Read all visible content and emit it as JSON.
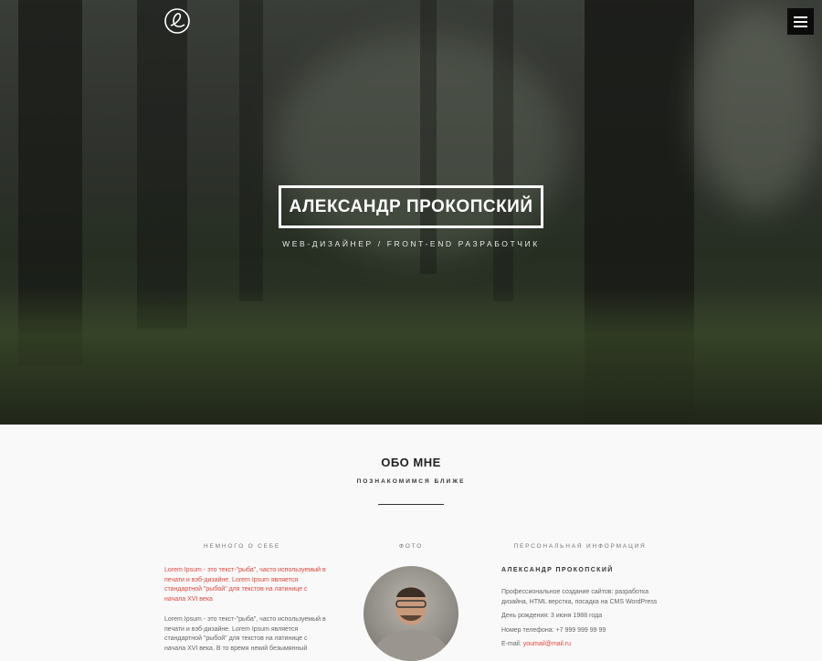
{
  "hero": {
    "name": "АЛЕКСАНДР ПРОКОПСКИЙ",
    "subtitle": "WEB-ДИЗАЙНЕР / FRONT-END РАЗРАБОТЧИК"
  },
  "about": {
    "title": "ОБО МНЕ",
    "subtitle": "ПОЗНАКОМИМСЯ БЛИЖЕ",
    "col1_head": "НЕМНОГО О СЕБЕ",
    "col2_head": "ФОТО",
    "col3_head": "ПЕРСОНАЛЬНАЯ ИНФОРМАЦИЯ",
    "para1": [
      "Lorem Ipsum - это текст-\"рыба\", часто используемый в",
      "печати и вэб-дизайне. Lorem Ipsum является",
      "стандартной \"рыбой\" для текстов на латинице с",
      "начала XVI века"
    ],
    "para2": [
      "Lorem Ipsum - это текст-\"рыба\", часто используемый в",
      "печати и вэб-дизайне. Lorem Ipsum является",
      "стандартной \"рыбой\" для текстов на латинице с",
      "начала XVI века. В то время некий безымянный"
    ],
    "info_name": "АЛЕКСАНДР ПРОКОПСКИЙ",
    "info_desc": [
      "Профессиональное создание сайтов: разработка",
      "дизайна, HTML верстка, посадка на CMS WordPress"
    ],
    "birthday": "День рождения: 3 июня 1988 года",
    "phone": "Номер телефона: +7 999 999 99 99",
    "email_label": "E-mail: ",
    "email": "youmail@mail.ru"
  },
  "icons": {
    "logo": "elementary-logo-icon",
    "menu": "hamburger-menu-icon"
  }
}
